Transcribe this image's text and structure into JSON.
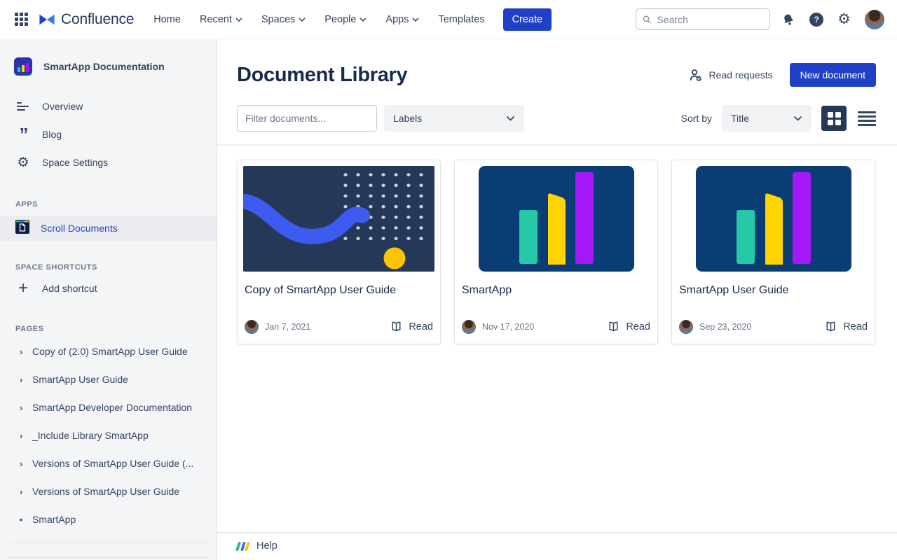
{
  "colors": {
    "accent_blue": "#2140C8",
    "nav_text": "#344563",
    "heading_text": "#172B4D",
    "muted_text": "#6B778C",
    "sidebar_bg": "#F4F5F7",
    "selected_row_bg": "#EBECF0",
    "thumb_squiggle_bg": "#253858",
    "squiggle_blue": "#3D5AF1",
    "dot_white": "#CBD3DD",
    "circle_yellow": "#FFC400",
    "thumb_bars_bg": "#0B3D75",
    "bar_teal": "#25C9A7",
    "bar_yellow": "#FFD400",
    "bar_purple": "#A219F6"
  },
  "icons": {
    "gear": "⚙",
    "plus": "+",
    "question": "?",
    "quote": "”"
  },
  "topbar": {
    "product": "Confluence",
    "nav": [
      {
        "label": "Home"
      },
      {
        "label": "Recent"
      },
      {
        "label": "Spaces"
      },
      {
        "label": "People"
      },
      {
        "label": "Apps"
      },
      {
        "label": "Templates"
      }
    ],
    "create_label": "Create",
    "search_placeholder": "Search"
  },
  "sidebar": {
    "space_name": "SmartApp Documentation",
    "nav_items": [
      {
        "label": "Overview"
      },
      {
        "label": "Blog"
      },
      {
        "label": "Space Settings"
      }
    ],
    "apps_header": "APPS",
    "apps_items": [
      {
        "label": "Scroll Documents"
      }
    ],
    "shortcuts_header": "SPACE SHORTCUTS",
    "add_shortcut_label": "Add shortcut",
    "pages_header": "PAGES",
    "pages": [
      {
        "label": "Copy of (2.0) SmartApp User Guide",
        "marker": "›"
      },
      {
        "label": "SmartApp User Guide",
        "marker": "›"
      },
      {
        "label": "SmartApp Developer Documentation",
        "marker": "›"
      },
      {
        "label": "_Include Library SmartApp",
        "marker": "›"
      },
      {
        "label": "Versions of SmartApp User Guide (...",
        "marker": "›"
      },
      {
        "label": "Versions of SmartApp User Guide",
        "marker": "›"
      },
      {
        "label": "SmartApp",
        "marker": "•"
      }
    ]
  },
  "main": {
    "title": "Document Library",
    "read_requests_label": "Read requests",
    "new_document_label": "New document",
    "filter_placeholder": "Filter documents...",
    "labels_value": "Labels",
    "sort_by_label": "Sort by",
    "sort_value": "Title",
    "cards": [
      {
        "title": "Copy of SmartApp User Guide",
        "date": "Jan 7, 2021",
        "action": "Read"
      },
      {
        "title": "SmartApp",
        "date": "Nov 17, 2020",
        "action": "Read"
      },
      {
        "title": "SmartApp User Guide",
        "date": "Sep 23, 2020",
        "action": "Read"
      }
    ],
    "help_label": "Help"
  }
}
